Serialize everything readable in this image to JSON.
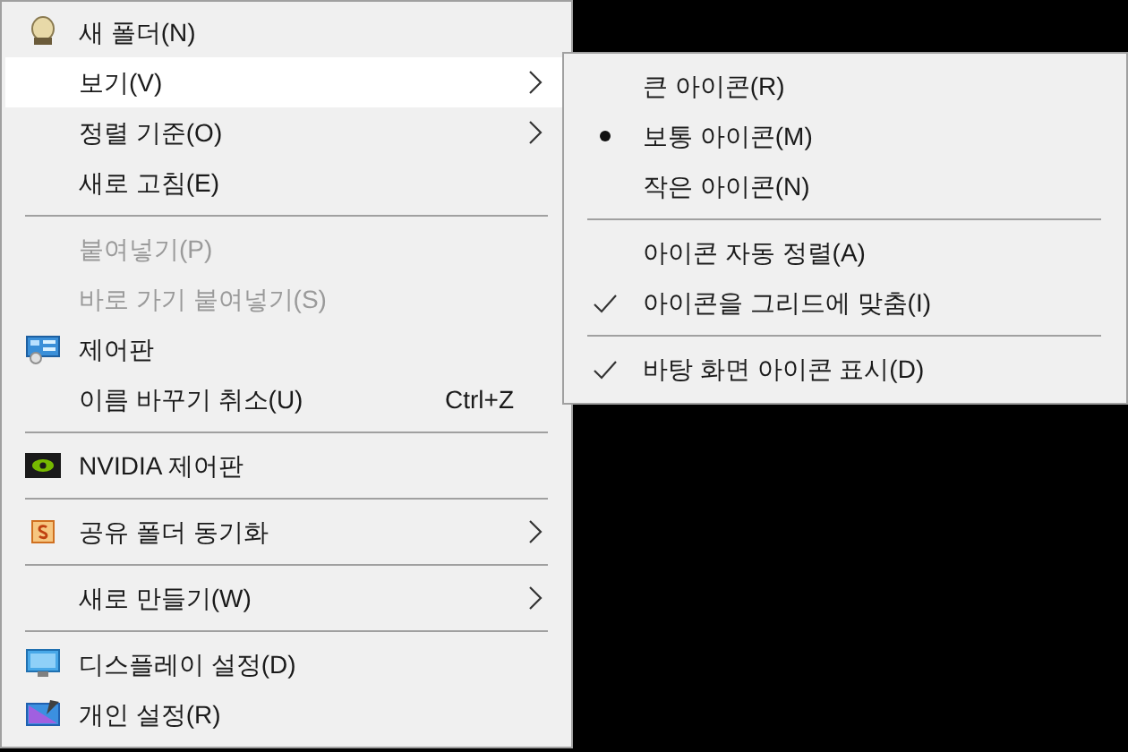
{
  "context_menu": {
    "items": [
      {
        "kind": "item",
        "label": "새 폴더(N)",
        "selected": false,
        "disabled": false
      },
      {
        "kind": "item",
        "label": "보기(V)",
        "submenu": true,
        "selected": true,
        "disabled": false
      },
      {
        "kind": "item",
        "label": "정렬 기준(O)",
        "submenu": true,
        "selected": false,
        "disabled": false
      },
      {
        "kind": "item",
        "label": "새로 고침(E)",
        "selected": false,
        "disabled": false
      },
      {
        "kind": "separator"
      },
      {
        "kind": "item",
        "label": "붙여넣기(P)",
        "selected": false,
        "disabled": true
      },
      {
        "kind": "item",
        "label": "바로 가기 붙여넣기(S)",
        "selected": false,
        "disabled": true
      },
      {
        "kind": "item",
        "label": "제어판",
        "selected": false,
        "disabled": false
      },
      {
        "kind": "item",
        "label": "이름 바꾸기 취소(U)",
        "shortcut": "Ctrl+Z",
        "selected": false,
        "disabled": false
      },
      {
        "kind": "separator"
      },
      {
        "kind": "item",
        "label": "NVIDIA 제어판",
        "selected": false,
        "disabled": false
      },
      {
        "kind": "separator"
      },
      {
        "kind": "item",
        "label": "공유 폴더 동기화",
        "submenu": true,
        "selected": false,
        "disabled": false
      },
      {
        "kind": "separator"
      },
      {
        "kind": "item",
        "label": "새로 만들기(W)",
        "submenu": true,
        "selected": false,
        "disabled": false
      },
      {
        "kind": "separator"
      },
      {
        "kind": "item",
        "label": "디스플레이 설정(D)",
        "selected": false,
        "disabled": false
      },
      {
        "kind": "item",
        "label": "개인 설정(R)",
        "selected": false,
        "disabled": false
      }
    ]
  },
  "view_submenu": {
    "items": [
      {
        "kind": "radio",
        "label": "큰 아이콘(R)",
        "selected": false
      },
      {
        "kind": "radio",
        "label": "보통 아이콘(M)",
        "selected": true
      },
      {
        "kind": "radio",
        "label": "작은 아이콘(N)",
        "selected": false
      },
      {
        "kind": "separator"
      },
      {
        "kind": "check",
        "label": "아이콘 자동 정렬(A)",
        "checked": false
      },
      {
        "kind": "check",
        "label": "아이콘을 그리드에 맞춤(I)",
        "checked": true
      },
      {
        "kind": "separator"
      },
      {
        "kind": "check",
        "label": "바탕 화면 아이콘 표시(D)",
        "checked": true
      }
    ]
  }
}
